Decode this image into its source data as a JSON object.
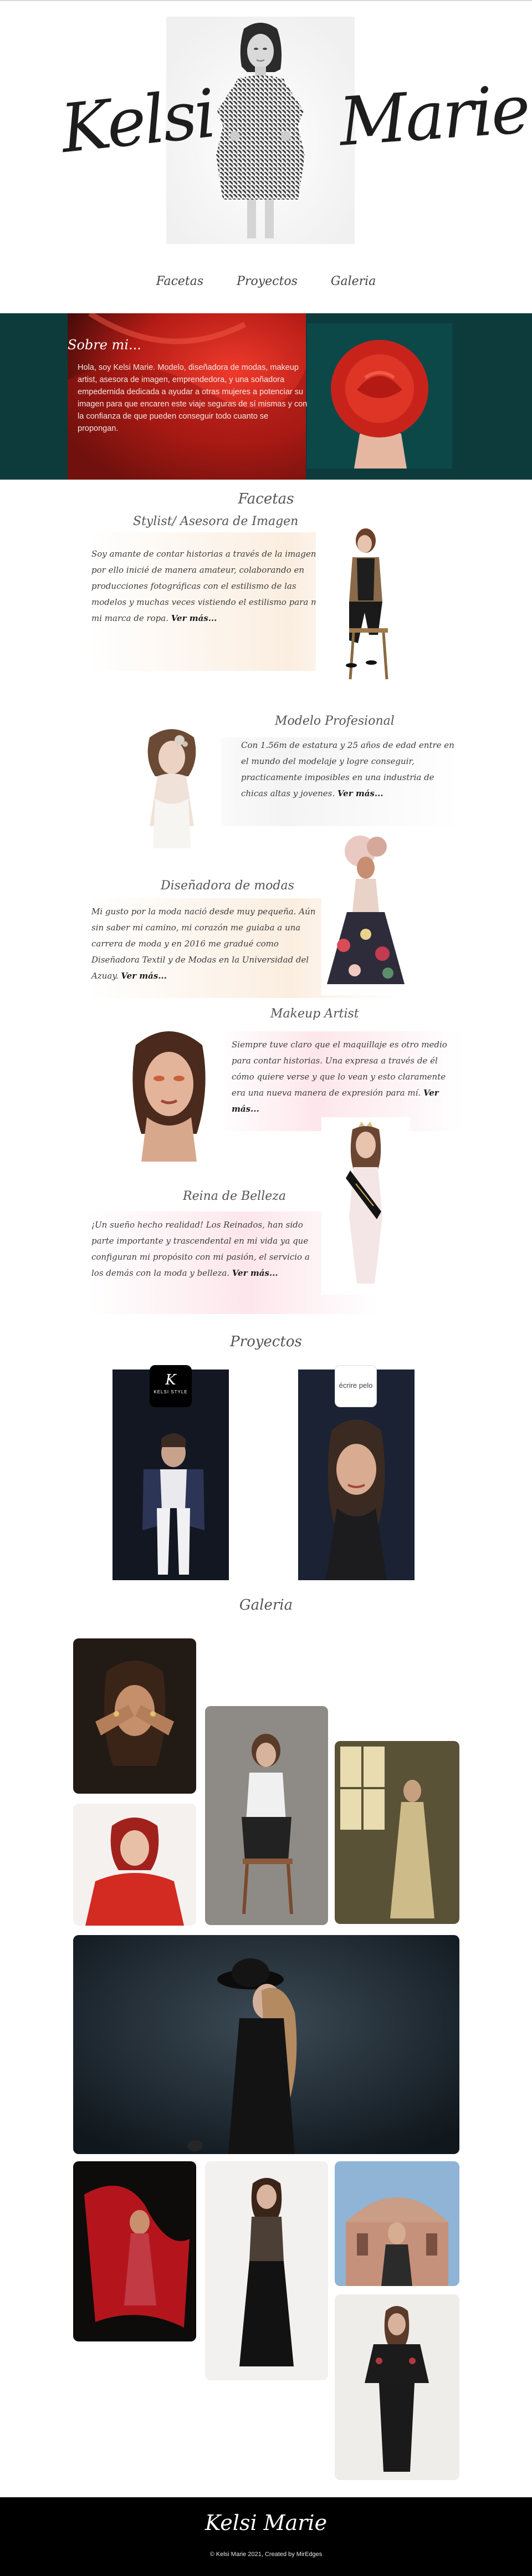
{
  "brand": {
    "first": "Kelsi",
    "last": "Marie"
  },
  "nav": [
    {
      "label": "Facetas"
    },
    {
      "label": "Proyectos"
    },
    {
      "label": "Galeria"
    }
  ],
  "about": {
    "title": "Sobre mi...",
    "text": "Hola, soy Kelsi Marie. Modelo, diseñadora de modas, makeup artist, asesora de imagen, emprendedora, y una soñadora empedernida dedicada a ayudar a otras mujeres a potenciar su imagen para que encaren este viaje seguras de sí mismas y con la confianza de que pueden conseguir todo cuanto se propongan."
  },
  "facetas": {
    "title": "Facetas",
    "items": [
      {
        "title": "Stylist/ Asesora de Imagen",
        "text": "Soy amante de contar historias a través de la imagen, y por ello inicié de manera amateur, colaborando en producciones fotográficas con el estilismo de las modelos y muchas veces vistiendo el estilismo para mí y mi marca de ropa. ",
        "more": "Ver más..."
      },
      {
        "title": "Modelo Profesional",
        "text": "Con 1.56m de estatura y 25 años de edad entre en el mundo del modelaje y logre conseguir, practicamente imposibles en una industria de chicas altas y jovenes. ",
        "more": "Ver más..."
      },
      {
        "title": "Diseñadora de modas",
        "text": "Mi gusto por la moda nació desde muy pequeña. Aún sin saber mi camino, mi corazón me guiaba a una carrera de moda y en 2016 me gradué como Diseñadora Textil y de Modas en la Universidad del Azuay. ",
        "more": "Ver más..."
      },
      {
        "title": "Makeup Artist",
        "text": "Siempre tuve claro que el maquillaje es otro medio para contar historias. Una expresa a través de él cómo quiere verse y que lo vean y esto claramente era una nueva manera de expresión para mí. ",
        "more": "Ver más..."
      },
      {
        "title": "Reina de Belleza",
        "text": "¡Un sueño hecho realidad! Los Reinados, han sido parte importante y trascendental en mi vida ya que configuran mi propósito con mi pasión, el servicio a los demás con la moda y belleza. ",
        "more": "Ver más..."
      }
    ]
  },
  "proyectos": {
    "title": "Proyectos",
    "items": [
      {
        "logo_line1": "K",
        "logo_line2": "KELSI STYLE"
      },
      {
        "logo_line1": "écrire pelo",
        "logo_line2": ""
      }
    ]
  },
  "galeria": {
    "title": "Galeria"
  },
  "footer": {
    "logo": "Kelsi Marie",
    "copyright": "© Kelsi Marie 2021, Created by MirEdges"
  },
  "colors": {
    "about_bg": "#0d3b3c",
    "rose": "#c8231b",
    "wash_peach": "#fbeee0",
    "wash_pink": "#fde6ec",
    "footer_bg": "#000000"
  }
}
